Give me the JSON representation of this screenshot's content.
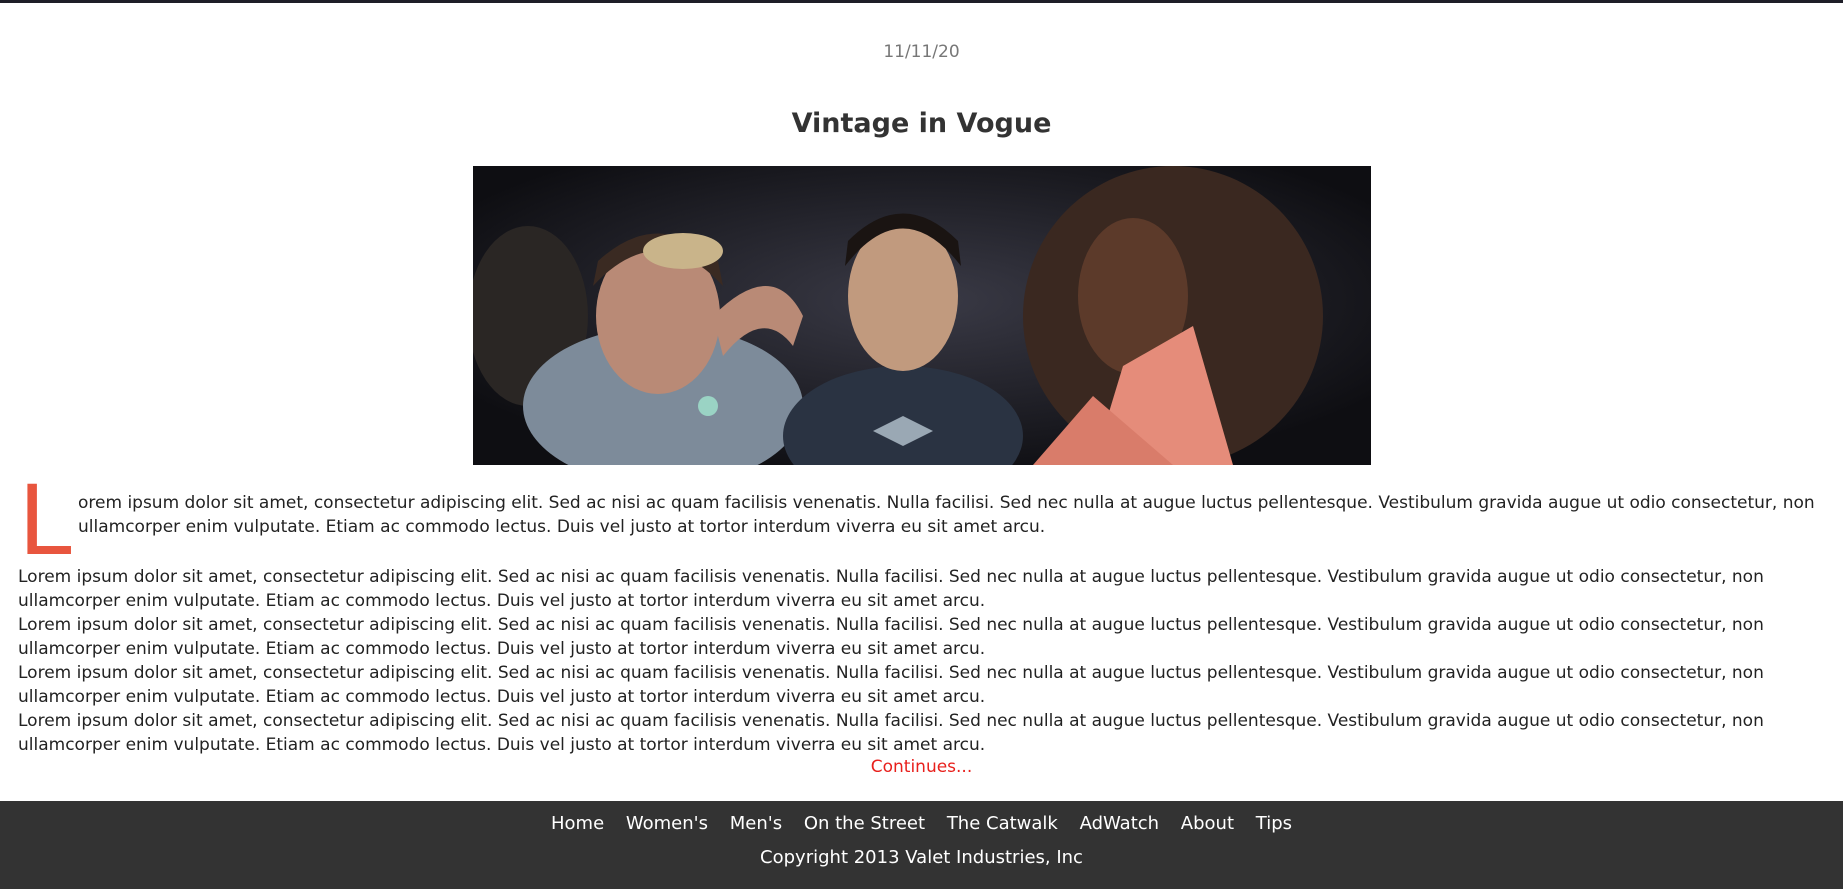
{
  "article": {
    "date": "11/11/20",
    "title": "Vintage in Vogue",
    "dropcap": "L",
    "lead_text": "orem ipsum dolor sit amet, consectetur adipiscing elit. Sed ac nisi ac quam facilisis venenatis. Nulla facilisi. Sed nec nulla at augue luctus pellentesque. Vestibulum gravida augue ut odio consectetur, non ullamcorper enim vulputate. Etiam ac commodo lectus. Duis vel justo at tortor interdum viverra eu sit amet arcu.",
    "paragraphs": [
      "Lorem ipsum dolor sit amet, consectetur adipiscing elit. Sed ac nisi ac quam facilisis venenatis. Nulla facilisi. Sed nec nulla at augue luctus pellentesque. Vestibulum gravida augue ut odio consectetur, non ullamcorper enim vulputate. Etiam ac commodo lectus. Duis vel justo at tortor interdum viverra eu sit amet arcu.",
      "Lorem ipsum dolor sit amet, consectetur adipiscing elit. Sed ac nisi ac quam facilisis venenatis. Nulla facilisi. Sed nec nulla at augue luctus pellentesque. Vestibulum gravida augue ut odio consectetur, non ullamcorper enim vulputate. Etiam ac commodo lectus. Duis vel justo at tortor interdum viverra eu sit amet arcu.",
      "Lorem ipsum dolor sit amet, consectetur adipiscing elit. Sed ac nisi ac quam facilisis venenatis. Nulla facilisi. Sed nec nulla at augue luctus pellentesque. Vestibulum gravida augue ut odio consectetur, non ullamcorper enim vulputate. Etiam ac commodo lectus. Duis vel justo at tortor interdum viverra eu sit amet arcu.",
      "Lorem ipsum dolor sit amet, consectetur adipiscing elit. Sed ac nisi ac quam facilisis venenatis. Nulla facilisi. Sed nec nulla at augue luctus pellentesque. Vestibulum gravida augue ut odio consectetur, non ullamcorper enim vulputate. Etiam ac commodo lectus. Duis vel justo at tortor interdum viverra eu sit amet arcu."
    ],
    "continues_label": "Continues..."
  },
  "footer": {
    "nav": [
      "Home",
      "Women's",
      "Men's",
      "On the Street",
      "The Catwalk",
      "AdWatch",
      "About",
      "Tips"
    ],
    "copyright": "Copyright 2013 Valet Industries, Inc"
  },
  "colors": {
    "accent": "#e8553e",
    "link": "#e8201c",
    "footer_bg": "#333333"
  }
}
